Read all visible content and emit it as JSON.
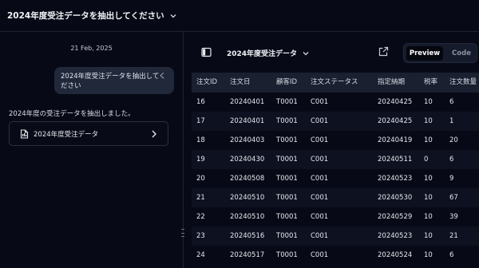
{
  "header": {
    "title": "2024年度受注データを抽出してください"
  },
  "chat": {
    "date": "21 Feb, 2025",
    "user_message": "2024年度受注データを抽出してください",
    "assistant_message": "2024年度の受注データを抽出しました。",
    "artifact_title": "2024年度受注データ"
  },
  "preview": {
    "title": "2024年度受注データ",
    "tabs": {
      "preview": "Preview",
      "code": "Code"
    },
    "table": {
      "columns": [
        "注文ID",
        "注文日",
        "顧客ID",
        "注文ステータス",
        "指定納期",
        "税率",
        "注文数量"
      ],
      "rows": [
        [
          "16",
          "20240401",
          "T0001",
          "C001",
          "20240425",
          "10",
          "6"
        ],
        [
          "17",
          "20240401",
          "T0001",
          "C001",
          "20240425",
          "10",
          "1"
        ],
        [
          "18",
          "20240403",
          "T0001",
          "C001",
          "20240419",
          "10",
          "20"
        ],
        [
          "19",
          "20240430",
          "T0001",
          "C001",
          "20240511",
          "0",
          "6"
        ],
        [
          "20",
          "20240508",
          "T0001",
          "C001",
          "20240523",
          "10",
          "9"
        ],
        [
          "21",
          "20240510",
          "T0001",
          "C001",
          "20240530",
          "10",
          "67"
        ],
        [
          "22",
          "20240510",
          "T0001",
          "C001",
          "20240529",
          "10",
          "39"
        ],
        [
          "23",
          "20240516",
          "T0001",
          "C001",
          "20240523",
          "10",
          "21"
        ],
        [
          "24",
          "20240517",
          "T0001",
          "C001",
          "20240524",
          "10",
          "6"
        ]
      ]
    }
  },
  "colors": {
    "background": "#070a16",
    "table_header": "#1a2030",
    "bubble": "#20283a"
  }
}
